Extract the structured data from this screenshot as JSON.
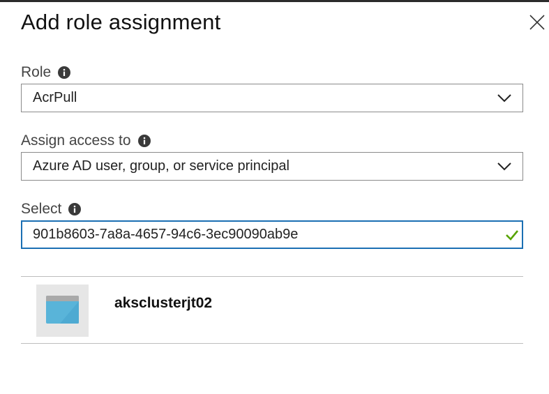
{
  "panel": {
    "title": "Add role assignment",
    "close_icon": "close-icon"
  },
  "role": {
    "label": "Role",
    "info_icon": "info-icon",
    "value": "AcrPull"
  },
  "assign_access": {
    "label": "Assign access to",
    "info_icon": "info-icon",
    "value": "Azure AD user, group, or service principal"
  },
  "select": {
    "label": "Select",
    "info_icon": "info-icon",
    "value": "901b8603-7a8a-4657-94c6-3ec90090ab9e",
    "valid_icon": "checkmark-icon",
    "valid_color": "#57a300"
  },
  "results": [
    {
      "name": "aksclusterjt02",
      "icon": "app-window-icon"
    }
  ],
  "colors": {
    "accent": "#1b6fb3",
    "tile_bg": "#e6e6e6",
    "app_icon": "#59b4d9"
  }
}
